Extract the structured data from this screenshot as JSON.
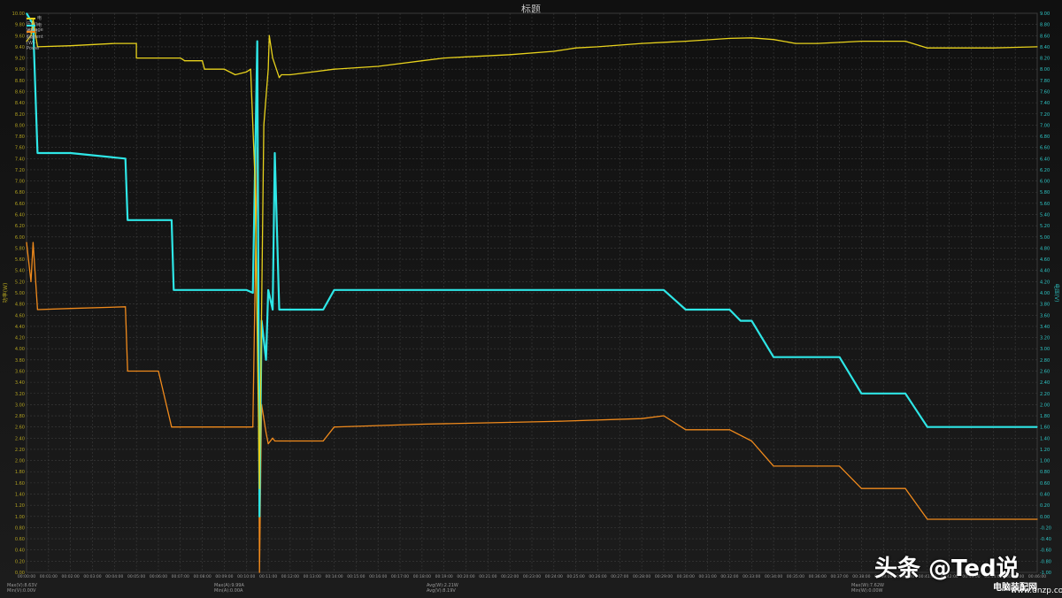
{
  "chart_data": {
    "type": "line",
    "title": "标题",
    "xlabel": "",
    "ylabel_left": "功率(W)",
    "ylabel_right": "电压(V)",
    "grid": true,
    "legend_position": "top-left",
    "x_range_min": [
      0,
      46
    ],
    "ylim_left": [
      0,
      10
    ],
    "ylim_right": [
      -1,
      9
    ],
    "x_tick_labels": [
      "00:00:00",
      "00:01:00",
      "00:02:00",
      "00:03:00",
      "00:04:00",
      "00:05:00",
      "00:06:00",
      "00:07:00",
      "00:08:00",
      "00:09:00",
      "00:10:00",
      "00:11:00",
      "00:12:00",
      "00:13:00",
      "00:14:00",
      "00:15:00",
      "00:16:00",
      "00:17:00",
      "00:18:00",
      "00:19:00",
      "00:20:00",
      "00:21:00",
      "00:22:00",
      "00:23:00",
      "00:24:00",
      "00:25:00",
      "00:26:00",
      "00:27:00",
      "00:28:00",
      "00:29:00",
      "00:30:00",
      "00:31:00",
      "00:32:00",
      "00:33:00",
      "00:34:00",
      "00:35:00",
      "00:36:00",
      "00:37:00",
      "00:38:00",
      "00:39:00",
      "00:40:00",
      "00:41:00",
      "00:42:00",
      "00:43:00",
      "00:44:00",
      "00:45:00",
      "00:46:00"
    ],
    "y_left_ticks": [
      "0.00",
      "0.20",
      "0.40",
      "0.60",
      "0.80",
      "1.00",
      "1.20",
      "1.40",
      "1.60",
      "1.80",
      "2.00",
      "2.20",
      "2.40",
      "2.60",
      "2.80",
      "3.00",
      "3.20",
      "3.40",
      "3.60",
      "3.80",
      "4.00",
      "4.20",
      "4.40",
      "4.60",
      "4.80",
      "5.00",
      "5.20",
      "5.40",
      "5.60",
      "5.80",
      "6.00",
      "6.20",
      "6.40",
      "6.60",
      "6.80",
      "7.00",
      "7.20",
      "7.40",
      "7.60",
      "7.80",
      "8.00",
      "8.20",
      "8.40",
      "8.60",
      "8.80",
      "9.00",
      "9.20",
      "9.40",
      "9.60",
      "9.80",
      "10.00"
    ],
    "y_right_ticks": [
      "-1.00",
      "-0.80",
      "-0.60",
      "-0.40",
      "-0.20",
      "0.00",
      "0.20",
      "0.40",
      "0.60",
      "0.80",
      "1.00",
      "1.20",
      "1.40",
      "1.60",
      "1.80",
      "2.00",
      "2.20",
      "2.40",
      "2.60",
      "2.80",
      "3.00",
      "3.20",
      "3.40",
      "3.60",
      "3.80",
      "4.00",
      "4.20",
      "4.40",
      "4.60",
      "4.80",
      "5.00",
      "5.20",
      "5.40",
      "5.60",
      "5.80",
      "6.00",
      "6.20",
      "6.40",
      "6.60",
      "6.80",
      "7.00",
      "7.20",
      "7.40",
      "7.60",
      "7.80",
      "8.00",
      "8.20",
      "8.40",
      "8.60",
      "8.80",
      "9.00"
    ],
    "series": [
      {
        "name": "电压(V)-Voltage",
        "color": "#e8d21c",
        "axis": "right",
        "x": [
          0,
          0.2,
          0.3,
          0.5,
          0.5,
          2,
          4,
          5,
          5,
          7,
          7.2,
          8,
          8.1,
          9,
          9.5,
          10,
          10.2,
          10.4,
          10.6,
          10.8,
          11,
          11.05,
          11.2,
          11.5,
          11.6,
          12,
          13,
          14,
          16,
          17,
          18,
          19,
          20,
          22,
          24,
          25,
          26,
          28,
          30,
          32,
          33,
          34,
          35,
          36,
          36.5,
          37,
          38,
          39,
          40,
          41,
          42,
          44,
          46
        ],
        "y": [
          8.5,
          8.6,
          8.9,
          8.4,
          8.4,
          8.42,
          8.46,
          8.46,
          8.2,
          8.2,
          8.15,
          8.15,
          8.0,
          8.0,
          7.9,
          7.95,
          8.0,
          6.0,
          0.5,
          7.0,
          8.0,
          8.6,
          8.2,
          7.85,
          7.9,
          7.9,
          7.95,
          8.0,
          8.05,
          8.1,
          8.15,
          8.2,
          8.22,
          8.26,
          8.32,
          8.38,
          8.4,
          8.46,
          8.5,
          8.55,
          8.56,
          8.53,
          8.46,
          8.46,
          8.47,
          8.48,
          8.5,
          8.5,
          8.5,
          8.38,
          8.38,
          8.38,
          8.4
        ]
      },
      {
        "name": "电流(A)-Current",
        "color": "#2ee6e6",
        "axis": "left",
        "x": [
          0,
          0.3,
          0.5,
          2,
          4.5,
          4.6,
          5,
          6,
          6.6,
          6.7,
          7,
          7.5,
          8.5,
          8.5,
          9,
          10,
          10.3,
          10.5,
          10.6,
          10.7,
          10.9,
          11,
          11.2,
          11.3,
          11.5,
          11.6,
          11.8,
          12,
          13.5,
          14,
          18,
          24,
          28,
          29,
          30,
          30.7,
          31,
          32,
          32.5,
          33,
          34,
          35,
          36,
          37,
          38,
          39,
          40,
          41,
          42,
          44,
          46
        ],
        "y": [
          10.0,
          9.8,
          7.5,
          7.5,
          7.4,
          6.3,
          6.3,
          6.3,
          6.3,
          5.05,
          5.05,
          5.05,
          5.05,
          5.05,
          5.05,
          5.05,
          5.0,
          9.5,
          1.0,
          4.5,
          3.8,
          5.05,
          4.7,
          7.5,
          4.7,
          4.7,
          4.7,
          4.7,
          4.7,
          5.05,
          5.05,
          5.05,
          5.05,
          5.05,
          4.7,
          4.7,
          4.7,
          4.7,
          4.5,
          4.5,
          3.85,
          3.85,
          3.85,
          3.85,
          3.2,
          3.2,
          3.2,
          2.6,
          2.6,
          2.6,
          2.6
        ]
      },
      {
        "name": "功率(W)-Power",
        "color": "#f08a1c",
        "axis": "left",
        "x": [
          0,
          0.2,
          0.3,
          0.5,
          2,
          4.5,
          4.6,
          5,
          6,
          6.6,
          6.7,
          7,
          8.5,
          9,
          10,
          10.3,
          10.5,
          10.6,
          10.7,
          10.9,
          11,
          11.2,
          11.3,
          11.5,
          11.6,
          11.8,
          12,
          13.5,
          14,
          18,
          24,
          28,
          29,
          30,
          31,
          32,
          33,
          34,
          35,
          36,
          37,
          38,
          39,
          40,
          41,
          42,
          44,
          46
        ],
        "y": [
          5.9,
          5.2,
          5.9,
          4.7,
          4.72,
          4.75,
          3.6,
          3.6,
          3.6,
          2.6,
          2.6,
          2.6,
          2.6,
          2.6,
          2.6,
          2.6,
          7.6,
          0.0,
          3.0,
          2.5,
          2.3,
          2.4,
          2.35,
          2.35,
          2.35,
          2.35,
          2.35,
          2.35,
          2.6,
          2.65,
          2.7,
          2.75,
          2.8,
          2.55,
          2.55,
          2.55,
          2.35,
          1.9,
          1.9,
          1.9,
          1.9,
          1.5,
          1.5,
          1.5,
          0.95,
          0.95,
          0.95,
          0.95
        ]
      }
    ],
    "footer_stats": [
      {
        "line1": "Max(V):8.63V",
        "line2": "Min(V):0.00V"
      },
      {
        "line1": "Max(A):9.99A",
        "line2": "Min(A):0.00A"
      },
      {
        "line1": "Avg(W):2.21W",
        "line2": "Avg(V):8.19V"
      },
      {
        "line1": "Max(W):7.62W",
        "line2": "Min(W):0.00W"
      }
    ]
  },
  "watermark": {
    "main": "头条 @Ted说",
    "sub": "电脑装配网",
    "url": "www.dnzp.com"
  }
}
